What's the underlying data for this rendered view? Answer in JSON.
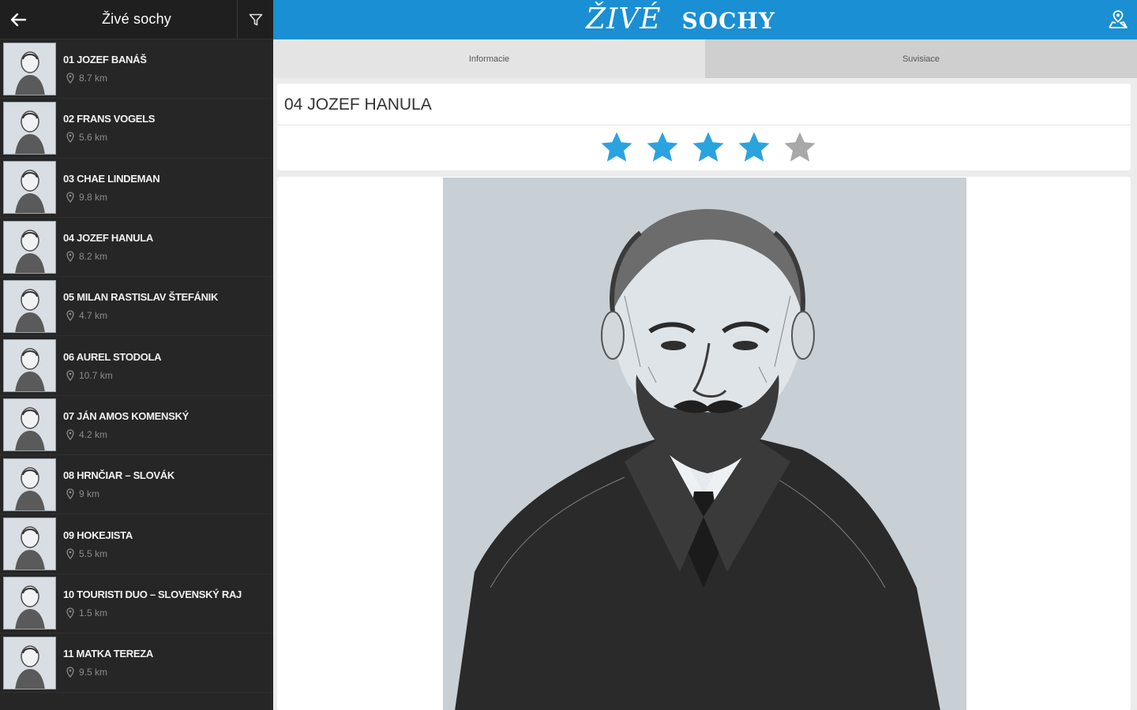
{
  "sidebar": {
    "title": "Živé sochy",
    "back_icon": "arrow-left-icon",
    "filter_icon": "filter-icon",
    "items": [
      {
        "name": "01 JOZEF BANÁŠ",
        "distance": "8.7 km"
      },
      {
        "name": "02 FRANS VOGELS",
        "distance": "5.6 km"
      },
      {
        "name": "03 CHAE LINDEMAN",
        "distance": "9.8 km"
      },
      {
        "name": "04 JOZEF HANULA",
        "distance": "8.2 km"
      },
      {
        "name": "05 MILAN RASTISLAV ŠTEFÁNIK",
        "distance": "4.7 km"
      },
      {
        "name": "06 AUREL STODOLA",
        "distance": "10.7 km"
      },
      {
        "name": "07 JÁN AMOS KOMENSKÝ",
        "distance": "4.2 km"
      },
      {
        "name": "08 HRNČIAR – SLOVÁK",
        "distance": "9 km"
      },
      {
        "name": "09 HOKEJISTA",
        "distance": "5.5 km"
      },
      {
        "name": "10 TOURISTI DUO – SLOVENSKÝ RAJ",
        "distance": "1.5 km"
      },
      {
        "name": "11 MATKA TEREZA",
        "distance": "9.5 km"
      }
    ]
  },
  "header": {
    "logo_word1": "ŽIVÉ",
    "logo_word2": "SOCHY",
    "right_icon": "map-location-icon",
    "bar_color": "#1a8fd3"
  },
  "tabs": [
    {
      "label": "Informacie",
      "active": true
    },
    {
      "label": "Suvisiace",
      "active": false
    }
  ],
  "detail": {
    "title": "04 JOZEF HANULA",
    "rating": 4,
    "rating_max": 5,
    "star_active_color": "#2aa3df",
    "star_inactive_color": "#a8a8a8",
    "image_icon": "portrait-sketch"
  }
}
